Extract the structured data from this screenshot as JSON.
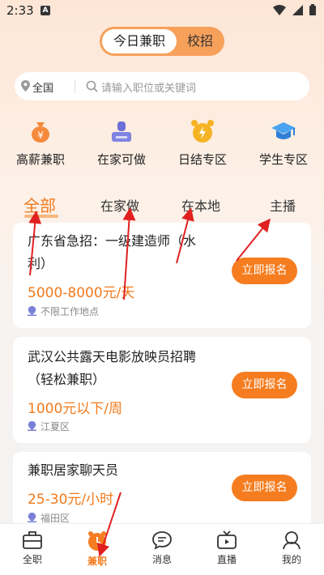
{
  "status_bar": {
    "time": "2:33",
    "notif_letter": "A"
  },
  "top_toggle": {
    "active": "今日兼职",
    "inactive": "校招"
  },
  "search": {
    "location": "全国",
    "placeholder": "请输入职位或关键词"
  },
  "categories": [
    {
      "label": "高薪兼职",
      "icon": "money-bag-icon"
    },
    {
      "label": "在家可做",
      "icon": "house-icon"
    },
    {
      "label": "日结专区",
      "icon": "alarm-clock-icon"
    },
    {
      "label": "学生专区",
      "icon": "graduation-cap-icon"
    }
  ],
  "tabs": [
    {
      "label": "全部",
      "active": true
    },
    {
      "label": "在家做",
      "active": false
    },
    {
      "label": "在本地",
      "active": false
    },
    {
      "label": "主播",
      "active": false
    }
  ],
  "jobs": [
    {
      "title": "广东省急招：一级建造师（水利）",
      "salary": "5000-8000元/天",
      "location": "不限工作地点",
      "button": "立即报名"
    },
    {
      "title": "武汉公共露天电影放映员招聘（轻松兼职）",
      "salary": "1000元以下/周",
      "location": "江夏区",
      "button": "立即报名"
    },
    {
      "title": "兼职居家聊天员",
      "salary": "25-30元/小时",
      "location": "福田区",
      "button": "立即报名"
    }
  ],
  "bottom_nav": [
    {
      "label": "全职",
      "icon": "briefcase-icon",
      "active": false
    },
    {
      "label": "兼职",
      "icon": "clock-icon",
      "active": true
    },
    {
      "label": "消息",
      "icon": "chat-icon",
      "active": false
    },
    {
      "label": "直播",
      "icon": "tv-icon",
      "active": false
    },
    {
      "label": "我的",
      "icon": "person-icon",
      "active": false
    }
  ],
  "colors": {
    "accent": "#f27a1c",
    "button": "#f57d20",
    "annotation_arrow": "#e02020"
  }
}
